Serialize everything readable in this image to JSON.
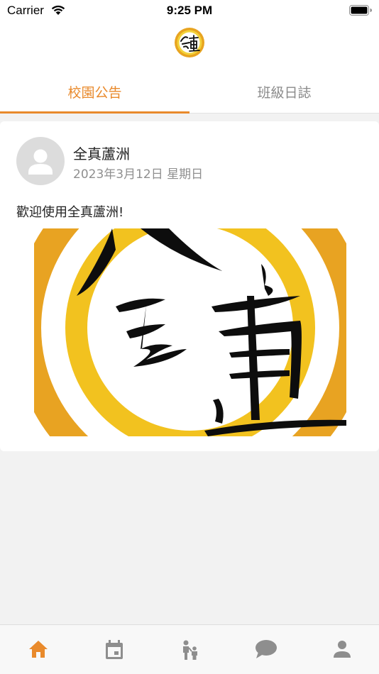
{
  "status_bar": {
    "carrier": "Carrier",
    "time": "9:25 PM"
  },
  "header": {
    "logo": "全真 logo"
  },
  "tabs": [
    {
      "label": "校園公告",
      "active": true
    },
    {
      "label": "班級日誌",
      "active": false
    }
  ],
  "post": {
    "author": "全真蘆洲",
    "date": "2023年3月12日 星期日",
    "text": "歡迎使用全真蘆洲!",
    "image": "全真 logo"
  },
  "bottom_nav": [
    {
      "icon": "home-icon",
      "active": true
    },
    {
      "icon": "calendar-icon",
      "active": false
    },
    {
      "icon": "parent-child-icon",
      "active": false
    },
    {
      "icon": "chat-icon",
      "active": false
    },
    {
      "icon": "profile-icon",
      "active": false
    }
  ],
  "colors": {
    "accent": "#e98a2c",
    "inactive": "#8a8a8a",
    "nav_inactive": "#8e8e8e"
  }
}
